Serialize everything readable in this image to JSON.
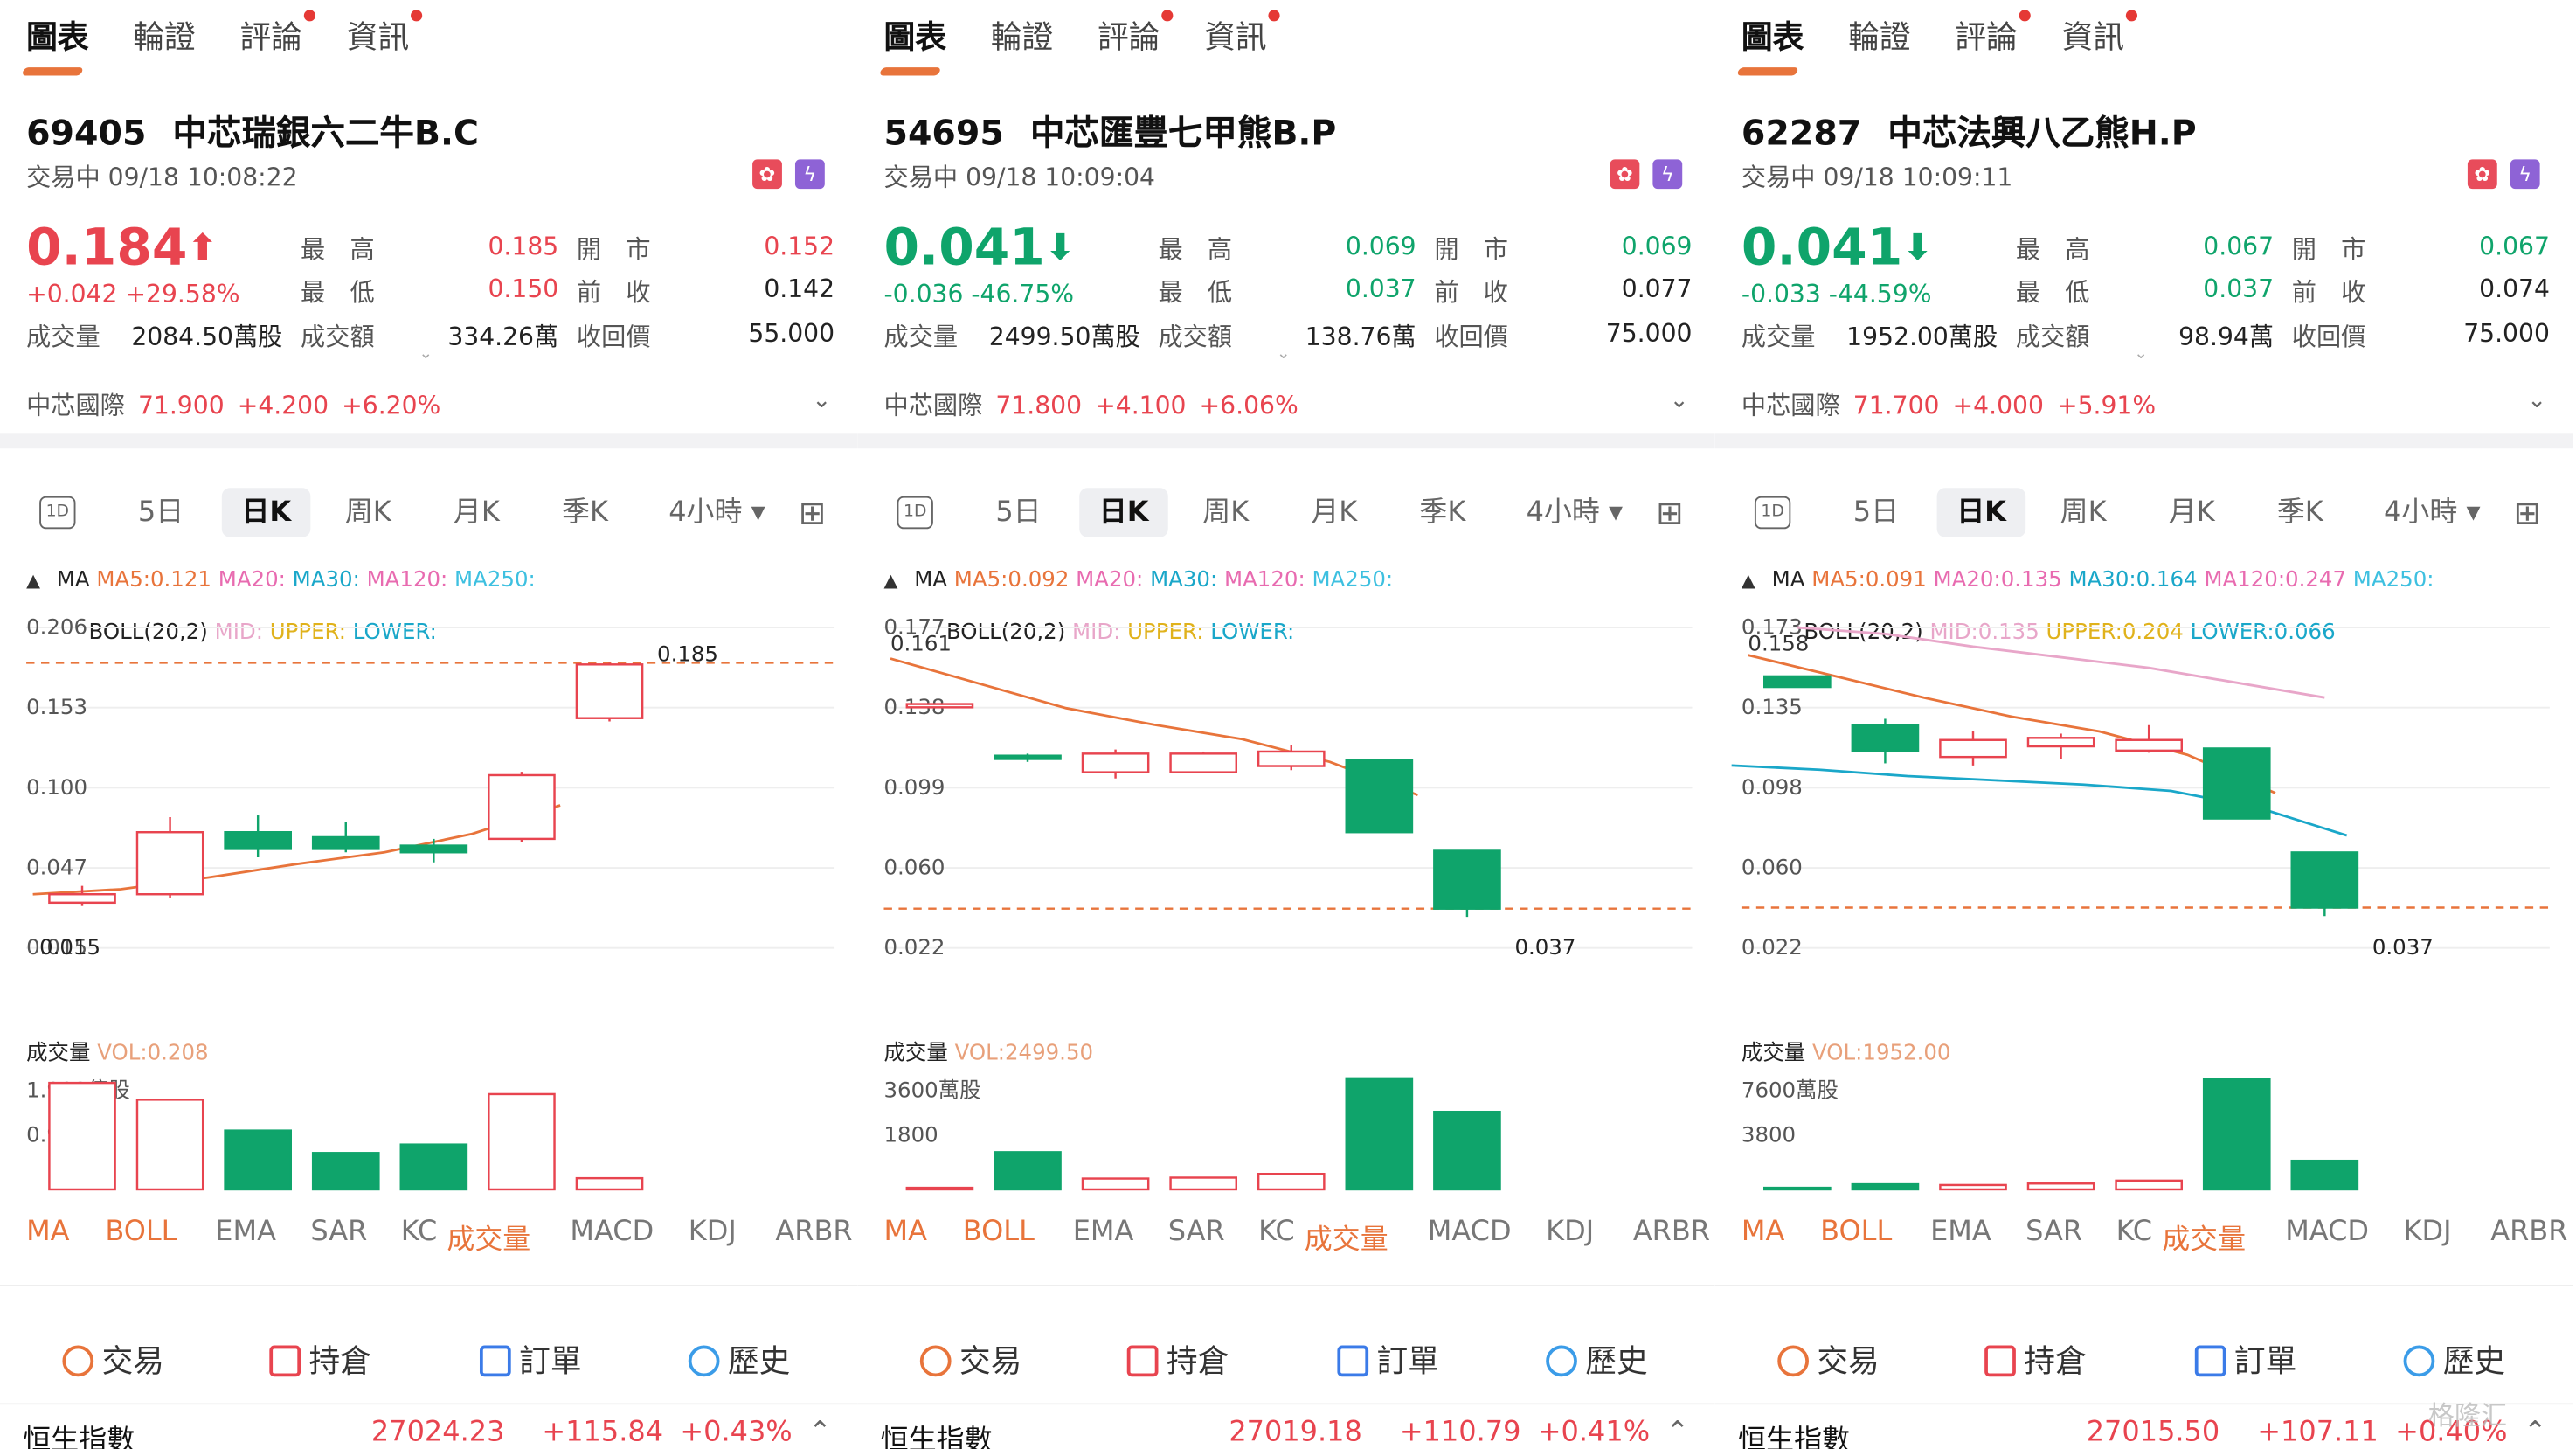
{
  "nav_tabs": [
    "圖表",
    "輪證",
    "評論",
    "資訊"
  ],
  "period_tabs": [
    "1D",
    "5日",
    "日K",
    "周K",
    "月K",
    "季K",
    "4小時"
  ],
  "indicator_tabs": [
    "MA",
    "BOLL",
    "EMA",
    "SAR",
    "KC",
    "成交量",
    "MACD",
    "KDJ",
    "ARBR"
  ],
  "action_tabs": [
    "交易",
    "持倉",
    "訂單",
    "歷史"
  ],
  "labels": {
    "high": "最　高",
    "open": "開　市",
    "low": "最　低",
    "prev": "前　收",
    "volume": "成交量",
    "turnover": "成交額",
    "callback": "收回價"
  },
  "colors": {
    "up": "#e8444f",
    "down": "#0fa46b",
    "accent": "#e8743b",
    "ma5": "#e8743b",
    "ma20": "#e86bb0",
    "ma30": "#1aa7c9",
    "ma120": "#e86bb0",
    "ma250": "#3ec0e0"
  },
  "panels": [
    {
      "code": "69405",
      "name": "中芯瑞銀六二牛B.C",
      "status": "交易中 09/18 10:08:22",
      "price": "0.184",
      "direction": "up",
      "change": "+0.042",
      "change_pct": "+29.58%",
      "high": "0.185",
      "open": "0.152",
      "low": "0.150",
      "prev_close": "0.142",
      "volume": "2084.50萬股",
      "turnover": "334.26萬",
      "callback_price": "55.000",
      "underlying": {
        "name": "中芯國際",
        "price": "71.900",
        "change": "+4.200",
        "pct": "+6.20%"
      },
      "ma_legend": {
        "ma5": "MA5:0.121",
        "ma20": "MA20:",
        "ma30": "MA30:",
        "ma120": "MA120:",
        "ma250": "MA250:"
      },
      "boll_legend": {
        "label": "BOLL(20,2)",
        "mid": "MID:",
        "upper": "UPPER:",
        "lower": "LOWER:"
      },
      "vol_legend": "VOL:0.208",
      "chart_data": {
        "type": "candlestick",
        "y_ticks": [
          "0.206",
          "0.153",
          "0.100",
          "0.047",
          "0.015"
        ],
        "ylim": [
          0.015,
          0.206
        ],
        "candles": [
          {
            "o": 0.042,
            "c": 0.047,
            "h": 0.052,
            "l": 0.04
          },
          {
            "o": 0.047,
            "c": 0.084,
            "h": 0.093,
            "l": 0.045
          },
          {
            "o": 0.084,
            "c": 0.074,
            "h": 0.094,
            "l": 0.069
          },
          {
            "o": 0.081,
            "c": 0.074,
            "h": 0.09,
            "l": 0.072
          },
          {
            "o": 0.076,
            "c": 0.072,
            "h": 0.08,
            "l": 0.066
          },
          {
            "o": 0.08,
            "c": 0.118,
            "h": 0.12,
            "l": 0.078
          },
          {
            "o": 0.152,
            "c": 0.184,
            "h": 0.185,
            "l": 0.15
          }
        ],
        "ma5": [
          0.047,
          0.05,
          0.057,
          0.065,
          0.072,
          0.083,
          0.1
        ],
        "high_label": "0.185",
        "low_label": "0.015",
        "ref_line": 0.185,
        "vol_ticks": [
          "1.993億股",
          "0.997"
        ],
        "vol_max": 1.993,
        "volumes": [
          1.9,
          1.6,
          1.05,
          0.65,
          0.8,
          1.7,
          0.2
        ]
      }
    },
    {
      "code": "54695",
      "name": "中芯匯豐七甲熊B.P",
      "status": "交易中 09/18 10:09:04",
      "price": "0.041",
      "direction": "down",
      "change": "-0.036",
      "change_pct": "-46.75%",
      "high": "0.069",
      "open": "0.069",
      "low": "0.037",
      "prev_close": "0.077",
      "volume": "2499.50萬股",
      "turnover": "138.76萬",
      "callback_price": "75.000",
      "underlying": {
        "name": "中芯國際",
        "price": "71.800",
        "change": "+4.100",
        "pct": "+6.06%"
      },
      "ma_legend": {
        "ma5": "MA5:0.092",
        "ma20": "MA20:",
        "ma30": "MA30:",
        "ma120": "MA120:",
        "ma250": "MA250:"
      },
      "boll_legend": {
        "label": "BOLL(20,2)",
        "mid": "MID:",
        "upper": "UPPER:",
        "lower": "LOWER:"
      },
      "vol_legend": "VOL:2499.50",
      "chart_data": {
        "type": "candlestick",
        "y_ticks": [
          "0.177",
          "0.138",
          "0.099",
          "0.060",
          "0.022"
        ],
        "ylim": [
          0.022,
          0.177
        ],
        "extra_tick": "0.161",
        "candles": [
          {
            "o": 0.14,
            "c": 0.14,
            "h": 0.14,
            "l": 0.14
          },
          {
            "o": 0.115,
            "c": 0.114,
            "h": 0.116,
            "l": 0.112
          },
          {
            "o": 0.107,
            "c": 0.116,
            "h": 0.118,
            "l": 0.104
          },
          {
            "o": 0.107,
            "c": 0.116,
            "h": 0.117,
            "l": 0.107
          },
          {
            "o": 0.11,
            "c": 0.117,
            "h": 0.12,
            "l": 0.108
          },
          {
            "o": 0.113,
            "c": 0.078,
            "h": 0.113,
            "l": 0.078
          },
          {
            "o": 0.069,
            "c": 0.041,
            "h": 0.069,
            "l": 0.037
          }
        ],
        "ma5": [
          0.162,
          0.15,
          0.138,
          0.13,
          0.123,
          0.112,
          0.096
        ],
        "low_label": "0.037",
        "ref_line": 0.041,
        "vol_ticks": [
          "3600萬股",
          "1800"
        ],
        "vol_max": 3600,
        "volumes": [
          0,
          1200,
          350,
          380,
          500,
          3580,
          2500
        ]
      }
    },
    {
      "code": "62287",
      "name": "中芯法興八乙熊H.P",
      "status": "交易中 09/18 10:09:11",
      "price": "0.041",
      "direction": "down",
      "change": "-0.033",
      "change_pct": "-44.59%",
      "high": "0.067",
      "open": "0.067",
      "low": "0.037",
      "prev_close": "0.074",
      "volume": "1952.00萬股",
      "turnover": "98.94萬",
      "callback_price": "75.000",
      "underlying": {
        "name": "中芯國際",
        "price": "71.700",
        "change": "+4.000",
        "pct": "+5.91%"
      },
      "ma_legend": {
        "ma5": "MA5:0.091",
        "ma20": "MA20:0.135",
        "ma30": "MA30:0.164",
        "ma120": "MA120:0.247",
        "ma250": "MA250:"
      },
      "boll_legend": {
        "label": "BOLL(20,2)",
        "mid": "MID:0.135",
        "upper": "UPPER:0.204",
        "lower": "LOWER:0.066"
      },
      "vol_legend": "VOL:1952.00",
      "chart_data": {
        "type": "candlestick",
        "y_ticks": [
          "0.173",
          "0.135",
          "0.098",
          "0.060",
          "0.022"
        ],
        "ylim": [
          0.022,
          0.173
        ],
        "extra_tick": "0.158",
        "candles": [
          {
            "o": 0.15,
            "c": 0.145,
            "h": 0.15,
            "l": 0.145
          },
          {
            "o": 0.127,
            "c": 0.115,
            "h": 0.13,
            "l": 0.109
          },
          {
            "o": 0.112,
            "c": 0.12,
            "h": 0.124,
            "l": 0.108
          },
          {
            "o": 0.117,
            "c": 0.121,
            "h": 0.123,
            "l": 0.111
          },
          {
            "o": 0.115,
            "c": 0.12,
            "h": 0.127,
            "l": 0.114
          },
          {
            "o": 0.116,
            "c": 0.083,
            "h": 0.116,
            "l": 0.083
          },
          {
            "o": 0.067,
            "c": 0.041,
            "h": 0.067,
            "l": 0.037
          }
        ],
        "ma5": [
          0.16,
          0.15,
          0.14,
          0.131,
          0.124,
          0.113,
          0.095
        ],
        "ma20": [
          0.108,
          0.106,
          0.103,
          0.101,
          0.099,
          0.096,
          0.088,
          0.075
        ],
        "ma120": [
          0.173,
          0.17,
          0.164,
          0.159,
          0.154,
          0.147,
          0.14
        ],
        "low_label": "0.037",
        "ref_line": 0.041,
        "vol_ticks": [
          "7600萬股",
          "3800"
        ],
        "vol_max": 7600,
        "volumes": [
          60,
          350,
          300,
          400,
          600,
          7500,
          1950
        ]
      }
    }
  ],
  "footer_ticker": [
    {
      "name": "恒生指數",
      "value": "27024.23",
      "change": "+115.84",
      "pct": "+0.43%"
    },
    {
      "name": "恒生指數",
      "value": "27019.18",
      "change": "+110.79",
      "pct": "+0.41%"
    },
    {
      "name": "恒生指數",
      "value": "27015.50",
      "change": "+107.11",
      "pct": "+0.40%"
    }
  ],
  "watermark": "格隆汇"
}
